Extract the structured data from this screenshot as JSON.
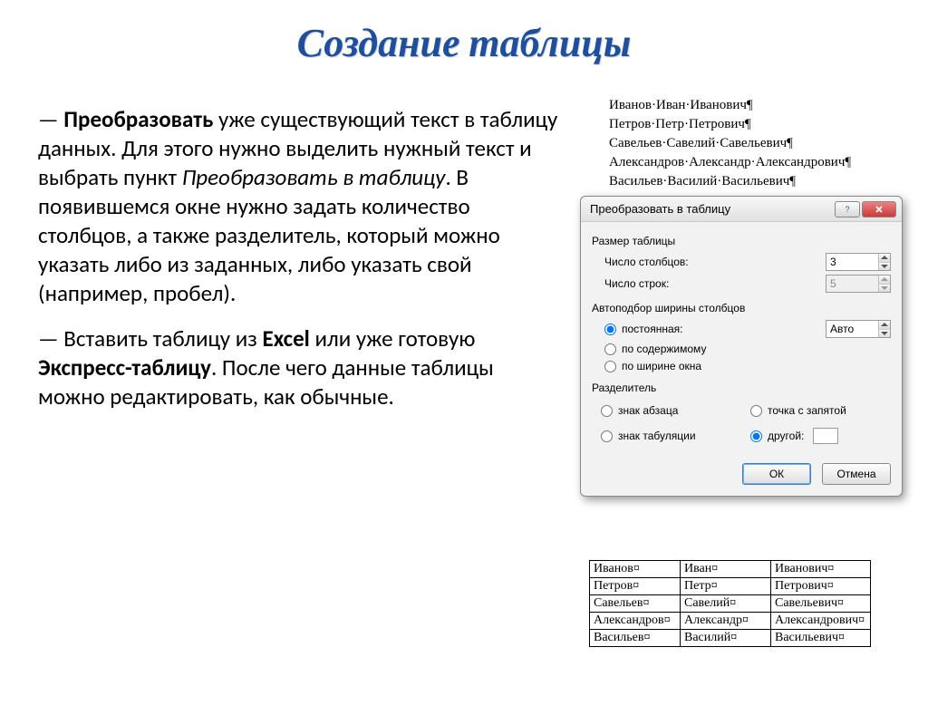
{
  "title": "Создание таблицы",
  "paragraph1": {
    "dash": "— ",
    "strong1": "Преобразовать",
    "t1": " уже существующий текст в таблицу данных. Для этого нужно выделить нужный текст и выбрать пункт ",
    "italic1": "Преобразовать в таблицу",
    "t2": ". В появившемся окне нужно задать количество столбцов, а также разделитель, который  можно указать либо из заданных, либо указать свой (например, пробел)."
  },
  "paragraph2": {
    "dash": "— Вставить таблицу из ",
    "strong1": "Excel",
    "t1": " или уже готовую ",
    "strong2": "Экспресс-таблицу",
    "t2": ". После чего данные таблицы можно редактировать, как обычные."
  },
  "names": [
    "Иванов·Иван·Иванович¶",
    "Петров·Петр·Петрович¶",
    "Савельев·Савелий·Савельевич¶",
    "Александров·Александр·Александрович¶",
    "Васильев·Василий·Васильевич¶"
  ],
  "dialog": {
    "title": "Преобразовать в таблицу",
    "size_section": "Размер таблицы",
    "cols_label": "Число столбцов:",
    "cols_value": "3",
    "rows_label": "Число строк:",
    "rows_value": "5",
    "autofit_section": "Автоподбор ширины столбцов",
    "opt_fixed": "постоянная:",
    "opt_fixed_value": "Авто",
    "opt_content": "по содержимому",
    "opt_window": "по ширине окна",
    "sep_section": "Разделитель",
    "sep_para": "знак абзаца",
    "sep_semi": "точка с запятой",
    "sep_tab": "знак табуляции",
    "sep_other": "другой:",
    "ok": "ОК",
    "cancel": "Отмена"
  },
  "table": [
    [
      "Иванов¤",
      "Иван¤",
      "Иванович¤"
    ],
    [
      "Петров¤",
      "Петр¤",
      "Петрович¤"
    ],
    [
      "Савельев¤",
      "Савелий¤",
      "Савельевич¤"
    ],
    [
      "Александров¤",
      "Александр¤",
      "Александрович¤"
    ],
    [
      "Васильев¤",
      "Василий¤",
      "Васильевич¤"
    ]
  ]
}
